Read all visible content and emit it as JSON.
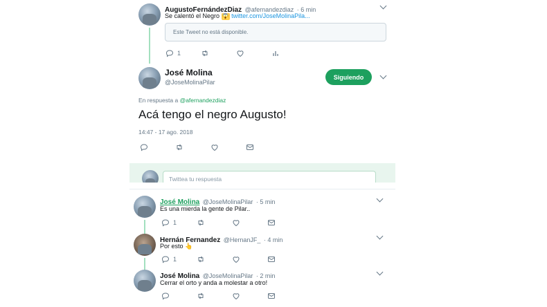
{
  "tweet1": {
    "name": "AugustoFernándezDiaz",
    "handle": "@afernandezdiaz",
    "time": "· 6 min",
    "text": "Se calentó el Negro",
    "emoji": "😱",
    "link": "twitter.com/JoseMolinaPila...",
    "quoted": "Este Tweet no está disponible.",
    "reply_count": "1"
  },
  "main": {
    "name": "José Molina",
    "handle": "@JoseMolinaPilar",
    "follow_label": "Siguiendo",
    "reply_prefix": "En respuesta a",
    "reply_to": "@afernandezdiaz",
    "text": "Acá tengo el negro Augusto!",
    "datetime": "14:47 - 17 ago. 2018"
  },
  "compose": {
    "placeholder": "Twittea tu respuesta"
  },
  "replies": [
    {
      "name": "José Molina",
      "handle": "@JoseMolinaPilar",
      "time": "· 5 min",
      "text": "Es una mierda la gente de Pilar..",
      "reply_count": "1"
    },
    {
      "name": "Hernán Fernandez",
      "handle": "@HernanJF_",
      "time": "· 4 min",
      "text": "Por esto 👆",
      "reply_count": "1"
    },
    {
      "name": "José Molina",
      "handle": "@JoseMolinaPilar",
      "time": "· 2 min",
      "text": "Cerrar el orto y anda a molestar a otro!",
      "reply_count": ""
    }
  ],
  "colors": {
    "accent_green": "#1da05e",
    "link_blue": "#1b95e0",
    "thread_line": "#a3e0bf"
  },
  "icons": [
    "reply-icon",
    "retweet-icon",
    "like-icon",
    "analytics-icon",
    "direct-message-icon",
    "chevron-down-icon"
  ]
}
